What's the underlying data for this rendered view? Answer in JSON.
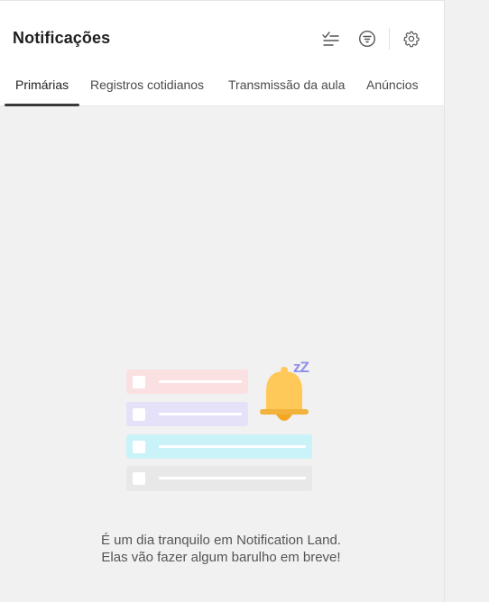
{
  "header": {
    "title": "Notificações"
  },
  "icons": {
    "mark_read": "checklist-icon",
    "filter": "filter-icon",
    "settings": "gear-icon"
  },
  "tabs": [
    {
      "label": "Primárias",
      "active": true
    },
    {
      "label": "Registros cotidianos",
      "active": false
    },
    {
      "label": "Transmissão da aula",
      "active": false
    },
    {
      "label": "Anúncios",
      "active": false
    }
  ],
  "empty_state": {
    "message": "É um dia tranquilo em Notification Land. Elas vão fazer algum barulho em breve!",
    "illustration": "sleeping-bell-illustration",
    "bell_label": "zZ"
  },
  "colors": {
    "header_bg": "#ffffff",
    "body_bg": "#f1f1f1",
    "bell": "#ffc95a",
    "row_pink": "#fbe0e2",
    "row_lavender": "#e4e1f9",
    "row_cyan": "#c9f3f8",
    "row_gray": "#e8e8e8",
    "zz": "#8f8fe8"
  }
}
